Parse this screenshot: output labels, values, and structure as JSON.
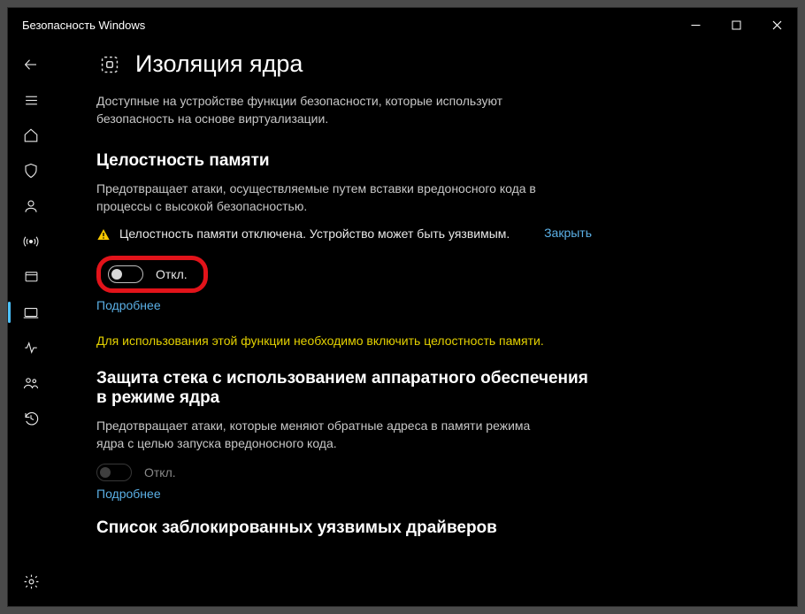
{
  "window": {
    "title": "Безопасность Windows"
  },
  "page": {
    "title": "Изоляция ядра",
    "lead": "Доступные на устройстве функции безопасности, которые используют безопасность на основе виртуализации."
  },
  "section1": {
    "heading": "Целостность памяти",
    "desc": "Предотвращает атаки, осуществляемые путем вставки вредоносного кода в процессы с высокой безопасностью.",
    "alert": "Целостность памяти отключена. Устройство может быть уязвимым.",
    "close": "Закрыть",
    "toggle_label": "Откл.",
    "more": "Подробнее"
  },
  "note": "Для использования этой функции необходимо включить целостность памяти.",
  "section2": {
    "heading": "Защита стека с использованием аппаратного обеспечения в режиме ядра",
    "desc": "Предотвращает атаки, которые меняют обратные адреса в памяти режима ядра с целью запуска вредоносного кода.",
    "toggle_label": "Откл.",
    "more": "Подробнее"
  },
  "section3": {
    "heading": "Список заблокированных уязвимых драйверов"
  }
}
